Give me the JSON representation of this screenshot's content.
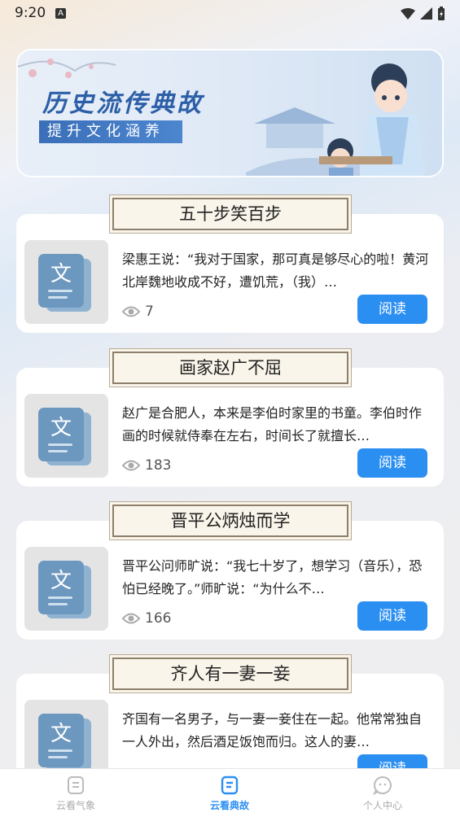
{
  "status": {
    "time": "9:20",
    "a_icon": "A"
  },
  "banner": {
    "title": "历史流传典故",
    "subtitle": "提升文化涵养"
  },
  "stories": [
    {
      "title": "五十步笑百步",
      "excerpt": "梁惠王说：“我对于国家，那可真是够尽心的啦！黄河北岸魏地收成不好，遭饥荒，（我）…",
      "views": "7",
      "read": "阅读",
      "thumb_char": "文"
    },
    {
      "title": "画家赵广不屈",
      "excerpt": "赵广是合肥人，本来是李伯时家里的书童。李伯时作画的时候就侍奉在左右，时间长了就擅长…",
      "views": "183",
      "read": "阅读",
      "thumb_char": "文"
    },
    {
      "title": "晋平公炳烛而学",
      "excerpt": "晋平公问师旷说：“我七十岁了，想学习（音乐），恐怕已经晚了。”师旷说：“为什么不…",
      "views": "166",
      "read": "阅读",
      "thumb_char": "文"
    },
    {
      "title": "齐人有一妻一妾",
      "excerpt": "齐国有一名男子，与一妻一妾住在一起。他常常独自一人外出，然后酒足饭饱而归。这人的妻…",
      "views": "",
      "read": "阅读",
      "thumb_char": "文"
    }
  ],
  "tabs": [
    {
      "label": "云看气象",
      "icon": "doc-list-icon"
    },
    {
      "label": "云看典故",
      "icon": "doc-text-icon",
      "active": true
    },
    {
      "label": "个人中心",
      "icon": "chat-face-icon"
    }
  ],
  "colors": {
    "accent": "#2b8ff2",
    "banner_title": "#2d5fa8"
  }
}
